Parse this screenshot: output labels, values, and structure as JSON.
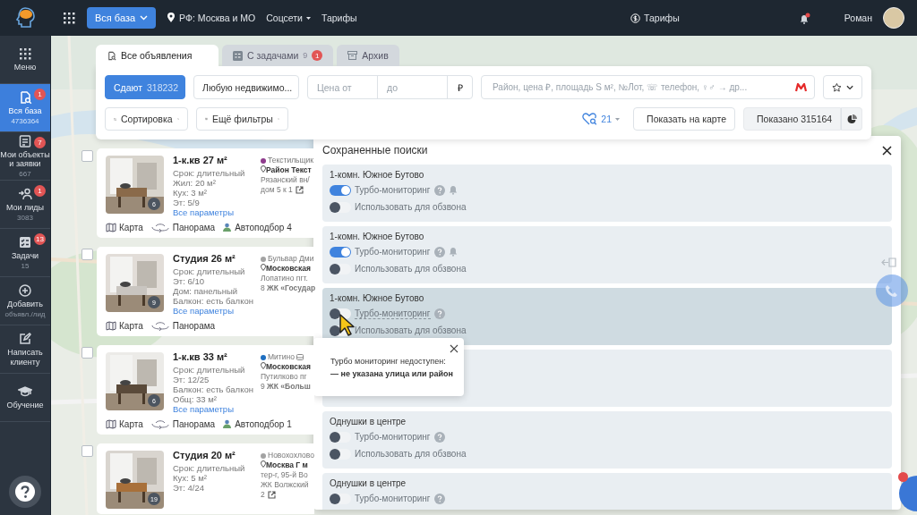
{
  "sidebar": {
    "items": [
      {
        "label": "Меню",
        "kind": "menu",
        "selected": false
      },
      {
        "label": "Вся база",
        "count": "4736364",
        "badge": "1",
        "kind": "search",
        "selected": true
      },
      {
        "label": "Мои объекты и заявки",
        "count": "667",
        "badge": "7",
        "kind": "objects",
        "selected": false
      },
      {
        "label": "Мои лиды",
        "count": "3083",
        "badge": "1",
        "kind": "leads",
        "selected": false
      },
      {
        "label": "Задачи",
        "count": "15",
        "badge": "13",
        "kind": "tasks",
        "selected": false
      },
      {
        "label": "Добавить",
        "count": "объявл./лид",
        "kind": "add",
        "selected": false
      },
      {
        "label": "Написать клиенту",
        "kind": "write",
        "selected": false
      },
      {
        "label": "Обучение",
        "kind": "learn",
        "selected": false
      }
    ]
  },
  "topbar": {
    "base_button": "Вся база",
    "location": "РФ: Москва и МО",
    "links": [
      {
        "label": "Соцсети",
        "kind": "dropdown"
      },
      {
        "label": "Тарифы",
        "kind": "plain"
      }
    ],
    "tariffs": "Тарифы",
    "user": "Роман"
  },
  "tabs": [
    {
      "label": "Все объявления",
      "kind": "all",
      "selected": true
    },
    {
      "label": "С задачами",
      "count": "9",
      "badge": "1",
      "kind": "tasks",
      "selected": false
    },
    {
      "label": "Архив",
      "kind": "archive",
      "selected": false
    }
  ],
  "filters": {
    "deal": "Сдают",
    "deal_count": "318232",
    "property": "Любую недвижимо...",
    "price_from": {
      "placeholder": "Цена от"
    },
    "price_to": {
      "placeholder": "до"
    },
    "currency": "₽",
    "search": {
      "placeholder": "Район, цена ₽, площадь S м², №Лот, ☏ телефон, ♀♂ → др..."
    },
    "sort": "Сортировка",
    "more": "Ещё фильтры",
    "saved_count": "21",
    "show_map": "Показать на карте",
    "shown": "Показано 315164"
  },
  "listings": [
    {
      "checked": false,
      "title": "1-к.кв 27 м²",
      "photo_count": "6",
      "params": [
        "Срок: длительный",
        "Жил: 20 м²",
        "Кух: 3 м²",
        "Эт: 5/9"
      ],
      "link": "Все параметры",
      "metro": "Текстильщик",
      "color": "#8e3b8c",
      "transport": false,
      "address": "Район Текст",
      "lines": [
        "Рязанский вн/",
        "дом 5 к 1"
      ],
      "external": true,
      "actions": [
        {
          "label": "Карта",
          "kind": "map"
        },
        {
          "label": "Панорама",
          "kind": "panorama"
        },
        {
          "label": "Автоподбор 4",
          "kind": "match"
        }
      ]
    },
    {
      "checked": false,
      "title": "Студия 26 м²",
      "photo_count": "9",
      "params": [
        "Срок: длительный",
        "Эт: 6/10",
        "Дом: панельный",
        "Балкон: есть балкон"
      ],
      "link": "Все параметры",
      "metro": "Бульвар Дми",
      "color": "#a3a3a3",
      "transport": false,
      "address": "Московская",
      "lines": [
        "Лопатино пгт.",
        "8 **ЖК «Государ**"
      ],
      "external": false,
      "actions": [
        {
          "label": "Карта",
          "kind": "map"
        },
        {
          "label": "Панорама",
          "kind": "panorama"
        }
      ]
    },
    {
      "checked": false,
      "title": "1-к.кв 33 м²",
      "photo_count": "6",
      "params": [
        "Срок: длительный",
        "Эт: 12/25",
        "Балкон: есть балкон",
        "Общ: 33 м²"
      ],
      "link": "Все параметры",
      "metro": "Митино",
      "color": "#1f6fc1",
      "transport": true,
      "address": "Московская",
      "lines": [
        "Путилково пг",
        "9 **ЖК «Больш**"
      ],
      "external": false,
      "actions": [
        {
          "label": "Карта",
          "kind": "map"
        },
        {
          "label": "Панорама",
          "kind": "panorama"
        },
        {
          "label": "Автоподбор 1",
          "kind": "match"
        }
      ]
    },
    {
      "checked": false,
      "title": "Студия 20 м²",
      "photo_count": "19",
      "params": [
        "Срок: длительный",
        "Кух: 5 м²",
        "Эт: 4/24"
      ],
      "metro": "Новохохлово",
      "color": "#a3a3a3",
      "transport": false,
      "address": "Москва Г м",
      "lines": [
        "тер-г, 95-й Во",
        "ЖК Волжский",
        "2"
      ],
      "external": true
    }
  ],
  "saved_searches": {
    "title": "Сохраненные поиски",
    "items": [
      {
        "kind": "search",
        "title": "1-комн. Южное Бутово",
        "highlighted": false,
        "rows": [
          {
            "label": "Турбо-мониторинг",
            "kind": "turbo",
            "on": true
          },
          {
            "label": "Использовать для обзвона",
            "kind": "call",
            "on": false
          }
        ]
      },
      {
        "kind": "search",
        "title": "1-комн. Южное Бутово",
        "highlighted": false,
        "rows": [
          {
            "label": "Турбо-мониторинг",
            "kind": "turbo",
            "on": true
          },
          {
            "label": "Использовать для обзвона",
            "kind": "call",
            "on": false
          }
        ]
      },
      {
        "kind": "search",
        "title": "1-комн. Южное Бутово",
        "highlighted": true,
        "rows": [
          {
            "label": "Турбо-мониторинг",
            "kind": "turbo",
            "on": false
          },
          {
            "label": "Использовать для обзвона",
            "kind": "call",
            "on": false
          }
        ]
      },
      {
        "kind": "covered",
        "highlighted": false
      },
      {
        "kind": "search",
        "title": "Однушки в центре",
        "highlighted": false,
        "rows": [
          {
            "label": "Турбо-мониторинг",
            "kind": "turbo",
            "on": false
          },
          {
            "label": "Использовать для обзвона",
            "kind": "call",
            "on": false
          }
        ]
      },
      {
        "kind": "search",
        "title": "Однушки в центре",
        "highlighted": false,
        "rows": [
          {
            "label": "Турбо-мониторинг",
            "kind": "turbo",
            "on": false
          }
        ]
      }
    ]
  },
  "tooltip": {
    "message": "Турбо мониторинг недоступен:",
    "reason": "— не указана улица или район"
  }
}
